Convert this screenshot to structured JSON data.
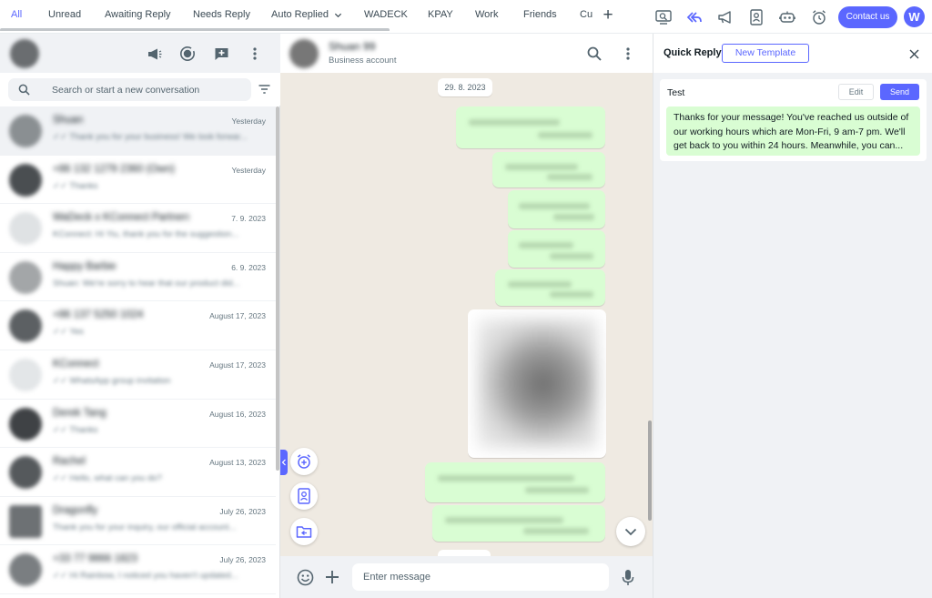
{
  "tabs": [
    {
      "label": "All",
      "active": true
    },
    {
      "label": "Unread"
    },
    {
      "label": "Awaiting Reply"
    },
    {
      "label": "Needs Reply"
    },
    {
      "label": "Auto Replied"
    },
    {
      "label": "WADECK"
    },
    {
      "label": "KPAY"
    },
    {
      "label": "Work"
    },
    {
      "label": "Friends"
    },
    {
      "label": "Cu"
    }
  ],
  "topbar": {
    "add_tab_symbol": "+",
    "icons": [
      "translate-icon",
      "reply-all-icon",
      "broadcast-icon",
      "contact-card-icon",
      "robot-icon",
      "alarm-clock-icon"
    ],
    "contact_button": "Contact us",
    "brand_logo": "W",
    "accent_color": "#5b67ff"
  },
  "left": {
    "search_placeholder": "Search or start a new conversation",
    "chats": [
      {
        "name": "Shuan",
        "time": "Yesterday",
        "preview": "✓✓ Thank you for your business! We look forwar..."
      },
      {
        "name": "+86 132 1279 2360 (Own)",
        "time": "Yesterday",
        "preview": "✓✓ Thanks"
      },
      {
        "name": "WaDeck x KConnect Partnership",
        "time": "7. 9. 2023",
        "preview": "KConnect: Hi Yiu, thank you for the suggestion..."
      },
      {
        "name": "Happy Barbie",
        "time": "6. 9. 2023",
        "preview": "Shuan: We're sorry to hear that our product did..."
      },
      {
        "name": "+86 137 5250 1024",
        "time": "August 17, 2023",
        "preview": "✓✓ Yes"
      },
      {
        "name": "KConnect",
        "time": "August 17, 2023",
        "preview": "✓✓ WhatsApp group invitation"
      },
      {
        "name": "Derek Tang",
        "time": "August 16, 2023",
        "preview": "✓✓ Thanks"
      },
      {
        "name": "Rachel",
        "time": "August 13, 2023",
        "preview": "✓✓ Hello, what can you do?"
      },
      {
        "name": "Dragonfly",
        "time": "July 26, 2023",
        "preview": "Thank you for your inquiry, our official account..."
      },
      {
        "name": "+33 77 9866 1823",
        "time": "July 26, 2023",
        "preview": "✓✓ Hi Rainbow, I noticed you haven't updated..."
      }
    ]
  },
  "conversation": {
    "contact_name": "Shuan 99",
    "subtitle": "Business account",
    "date_label": "29. 8. 2023",
    "composer_placeholder": "Enter message",
    "bubble_color": "#d9fdd3",
    "background_color": "#efeae2"
  },
  "quick_reply": {
    "title": "Quick Reply",
    "new_template_button": "New Template",
    "template": {
      "name": "Test",
      "edit_button": "Edit",
      "send_button": "Send",
      "body": "Thanks for your message! You've reached us outside of our working hours which are Mon-Fri, 9 am-7 pm. We'll get back to you within 24 hours. Meanwhile, you can..."
    }
  }
}
